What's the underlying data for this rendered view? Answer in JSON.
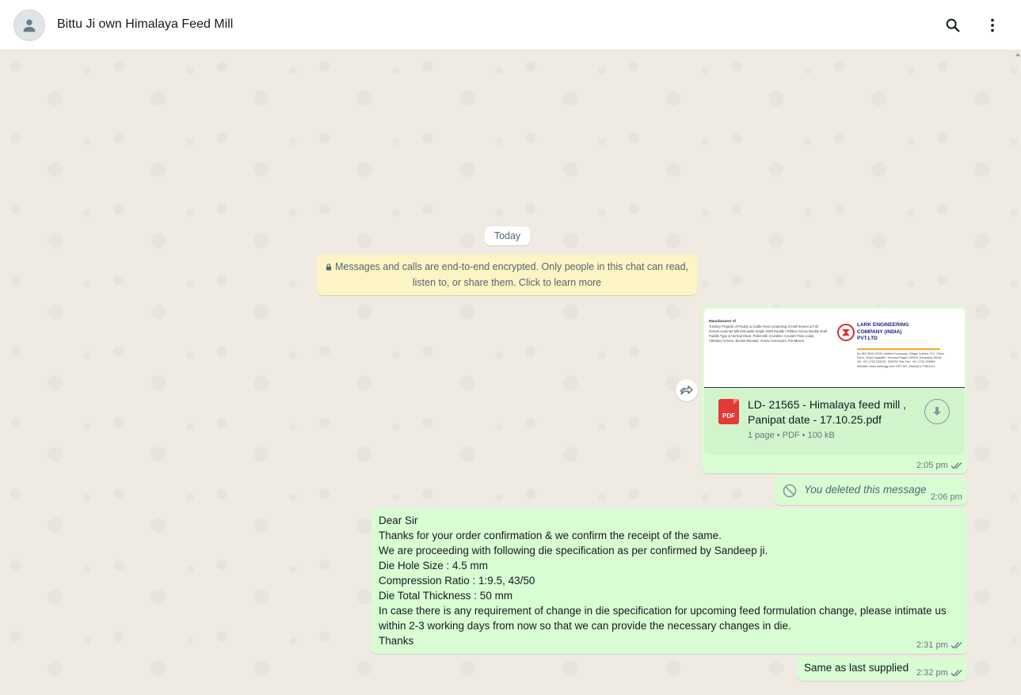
{
  "header": {
    "contact_name": "Bittu Ji own Himalaya Feed Mill"
  },
  "chat": {
    "date_chip": "Today",
    "encryption_notice": "Messages and calls are end-to-end encrypted. Only people in this chat can read, listen to, or share them. Click to learn more",
    "messages": [
      {
        "type": "document",
        "preview": {
          "left_heading": "Manufacturer of",
          "left_text": "Turnkey Projects of Poultry & Cattle Feed comprising of Half Screen & Full Screen Hammer Mill Dismantle Single shaft Double / Ribbon Screw Double shaft Paddle Type & Vertical Mixer, Pellet Mill, Crumbler, Counter Flow cooler, Vibratory Screen, Bucket Elevator, Screw Conveyors, Pre-Mixers",
          "company_name": "LARK ENGINEERING COMPANY (INDIA) PVT.LTD",
          "address": "An ISO 9001:2015 Certified Company, Village Sutheri, P.O. Shiva Farm, Tehsil Jagadhri, Yamuna Nagar-135001 (Haryana) INDIA. Tel: +91 1732-254001, 320034 Tele Fax: +91 1732-299801 Website: www.larkengg.com GST NO. 06AAACL7786J1ZL"
        },
        "file_name": "LD- 21565 - Himalaya feed mill , Panipat date - 17.10.25.pdf",
        "file_type_badge": "PDF",
        "file_meta": "1 page • PDF • 100 kB",
        "time": "2:05 pm"
      },
      {
        "type": "deleted",
        "text": "You deleted this message",
        "time": "2:06 pm"
      },
      {
        "type": "text",
        "lines": [
          "Dear Sir",
          "Thanks for your order confirmation & we confirm the receipt of the same.",
          "We are proceeding with following die specification as per confirmed by Sandeep ji.",
          "Die Hole Size : 4.5 mm",
          "Compression Ratio : 1:9.5, 43/50",
          "Die Total Thickness : 50 mm",
          "In case there is any requirement of change in die specification for upcoming feed formulation change, please intimate us within 2-3 working days from now so that we can provide the necessary changes in die.",
          "Thanks"
        ],
        "time": "2:31 pm"
      },
      {
        "type": "text",
        "text": "Same as last supplied",
        "time": "2:32 pm"
      }
    ]
  },
  "colors": {
    "outgoing_bubble": "#d9fdd3",
    "chat_background": "#efeae2",
    "encryption_notice_bg": "#fdf4c5",
    "read_tick": "#667781",
    "pdf_icon": "#e53935"
  },
  "icons": {
    "avatar": "person-icon",
    "search": "search-icon",
    "menu": "kebab-menu-icon",
    "lock": "lock-icon",
    "forward": "forward-icon",
    "download": "download-icon",
    "deleted": "prohibited-icon",
    "ticks": "double-check-icon"
  }
}
